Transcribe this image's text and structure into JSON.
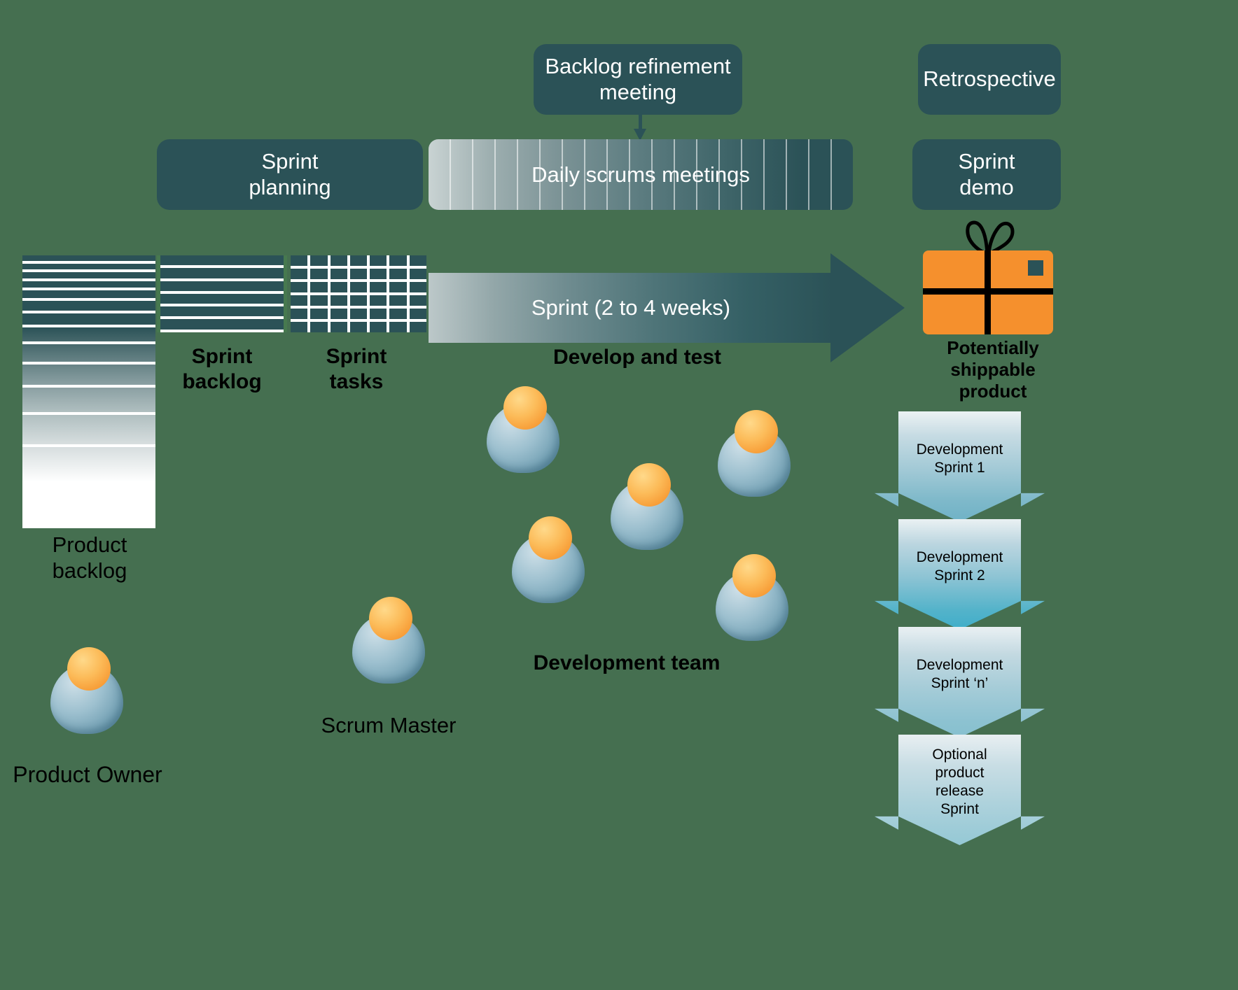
{
  "colors": {
    "background": "#456f50",
    "teal": "#2b5257",
    "orange": "#f5902d",
    "white": "#ffffff",
    "grid_green": "#47794f"
  },
  "boxes": {
    "backlog_refinement": "Backlog refinement\nmeeting",
    "backlog_refinement_line1": "Backlog refinement",
    "backlog_refinement_line2": "meeting",
    "retrospective": "Retrospective",
    "sprint_planning_line1": "Sprint",
    "sprint_planning_line2": "planning",
    "sprint_demo_line1": "Sprint",
    "sprint_demo_line2": "demo",
    "daily_scrums": "Daily scrums meetings",
    "sprint_arrow": "Sprint (2 to 4 weeks)"
  },
  "labels": {
    "product_backlog_line1": "Product",
    "product_backlog_line2": "backlog",
    "sprint_backlog_line1": "Sprint",
    "sprint_backlog_line2": "backlog",
    "sprint_tasks_line1": "Sprint",
    "sprint_tasks_line2": "tasks",
    "develop_and_test": "Develop and test",
    "development_team": "Development team",
    "scrum_master": "Scrum Master",
    "product_owner": "Product Owner",
    "shippable_line1": "Potentially",
    "shippable_line2": "shippable",
    "shippable_line3": "product"
  },
  "sprint_stack": [
    {
      "line1": "Development",
      "line2": "Sprint 1",
      "line3": "",
      "line4": ""
    },
    {
      "line1": "Development",
      "line2": "Sprint 2",
      "line3": "",
      "line4": ""
    },
    {
      "line1": "Development",
      "line2": "Sprint ‘n’",
      "line3": "",
      "line4": ""
    },
    {
      "line1": "Optional",
      "line2": "product",
      "line3": "release",
      "line4": "Sprint"
    }
  ],
  "counts": {
    "product_backlog_rows": 14,
    "sprint_backlog_rows": 6,
    "sprint_task_columns": 7,
    "sprint_task_rows": 6,
    "daily_scrum_ticks": 19,
    "development_team_people": 5
  },
  "icons": {
    "gift": "gift-icon",
    "arrow_right": "arrow-right-icon",
    "arrow_down": "arrow-down-icon",
    "person": "person-icon"
  }
}
